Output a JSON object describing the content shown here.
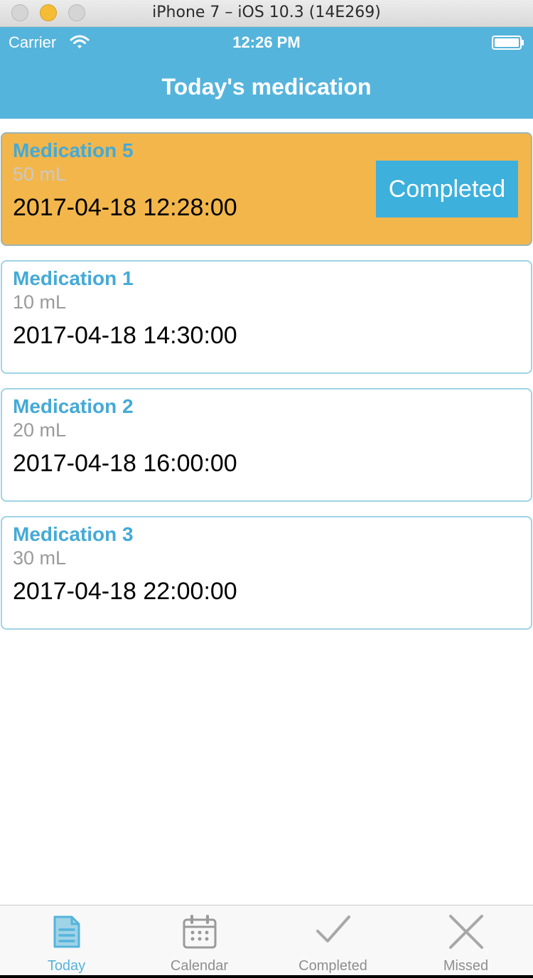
{
  "window": {
    "title": "iPhone 7 – iOS 10.3 (14E269)"
  },
  "status_bar": {
    "carrier": "Carrier",
    "time": "12:26 PM"
  },
  "nav": {
    "title": "Today's medication"
  },
  "medications": [
    {
      "name": "Medication 5",
      "dose": "50 mL",
      "time": "2017-04-18 12:28:00",
      "action_label": "Completed"
    },
    {
      "name": "Medication 1",
      "dose": "10 mL",
      "time": "2017-04-18 14:30:00"
    },
    {
      "name": "Medication 2",
      "dose": "20 mL",
      "time": "2017-04-18 16:00:00"
    },
    {
      "name": "Medication 3",
      "dose": "30 mL",
      "time": "2017-04-18 22:00:00"
    }
  ],
  "tabs": [
    {
      "label": "Today",
      "icon": "document-icon",
      "active": true
    },
    {
      "label": "Calendar",
      "icon": "calendar-icon",
      "active": false
    },
    {
      "label": "Completed",
      "icon": "checkmark-icon",
      "active": false
    },
    {
      "label": "Missed",
      "icon": "x-icon",
      "active": false
    }
  ],
  "colors": {
    "header": "#55b4dc",
    "accent": "#45aad6",
    "current_card": "#f2b64b",
    "complete_button": "#3db0dc",
    "tab_inactive": "#8e8e8e"
  }
}
